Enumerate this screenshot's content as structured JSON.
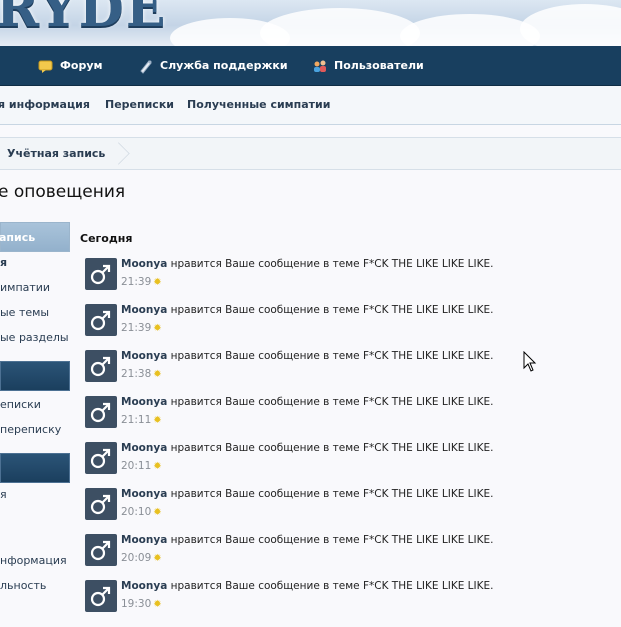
{
  "header": {
    "logo_text": "RYDE"
  },
  "nav": {
    "items": [
      {
        "label": "Форум",
        "icon": "forum-icon"
      },
      {
        "label": "Служба поддержки",
        "icon": "support-icon"
      },
      {
        "label": "Пользователи",
        "icon": "users-icon"
      }
    ]
  },
  "subnav": {
    "items": [
      "я информация",
      "Переписки",
      "Полученные симпатии"
    ]
  },
  "breadcrumb": {
    "item": "Учётная запись"
  },
  "page": {
    "title": "е оповещения"
  },
  "sidebar": {
    "section1": "апись",
    "links1": [
      "я",
      "импатии",
      "ые темы",
      "ые разделы"
    ],
    "section2": "",
    "links2": [
      "еписки",
      "переписку"
    ],
    "section3": "",
    "links3": [
      "я",
      "",
      "нформация",
      "льность"
    ]
  },
  "alerts": {
    "section_title": "Сегодня",
    "items": [
      {
        "user": "Moonya",
        "text": "нравится Ваше сообщение в теме F*CK THE LIKE LIKE LIKE.",
        "time": "21:39"
      },
      {
        "user": "Moonya",
        "text": "нравится Ваше сообщение в теме F*CK THE LIKE LIKE LIKE.",
        "time": "21:39"
      },
      {
        "user": "Moonya",
        "text": "нравится Ваше сообщение в теме F*CK THE LIKE LIKE LIKE.",
        "time": "21:38"
      },
      {
        "user": "Moonya",
        "text": "нравится Ваше сообщение в теме F*CK THE LIKE LIKE LIKE.",
        "time": "21:11"
      },
      {
        "user": "Moonya",
        "text": "нравится Ваше сообщение в теме F*CK THE LIKE LIKE LIKE.",
        "time": "20:11"
      },
      {
        "user": "Moonya",
        "text": "нравится Ваше сообщение в теме F*CK THE LIKE LIKE LIKE.",
        "time": "20:10"
      },
      {
        "user": "Moonya",
        "text": "нравится Ваше сообщение в теме F*CK THE LIKE LIKE LIKE.",
        "time": "20:09"
      },
      {
        "user": "Moonya",
        "text": "нравится Ваше сообщение в теме F*CK THE LIKE LIKE LIKE.",
        "time": "19:30"
      }
    ]
  }
}
